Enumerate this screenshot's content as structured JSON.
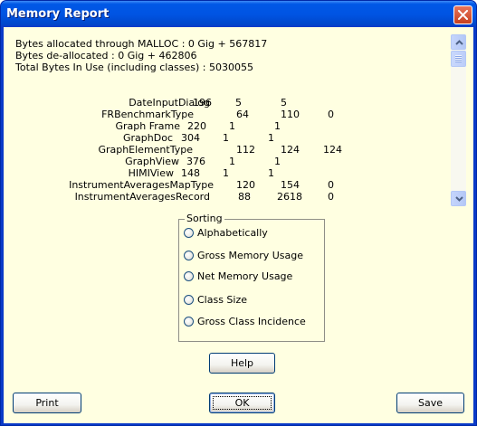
{
  "window": {
    "title": "Memory Report"
  },
  "report": {
    "info_lines": [
      "Bytes allocated through MALLOC : 0 Gig + 567817",
      "Bytes de-allocated : 0 Gig + 462806",
      "Total Bytes In Use (including classes) : 5030055"
    ],
    "rows": [
      {
        "name": "DateInputDialog",
        "values": [
          "196",
          "5",
          "5"
        ]
      },
      {
        "name": "FRBenchmarkType",
        "values": [
          "64",
          "110",
          "0"
        ]
      },
      {
        "name": "Graph Frame",
        "values": [
          "220",
          "1",
          "1"
        ]
      },
      {
        "name": "GraphDoc",
        "values": [
          "304",
          "1",
          "1"
        ]
      },
      {
        "name": "GraphElementType",
        "values": [
          "112",
          "124",
          "124"
        ]
      },
      {
        "name": "GraphView",
        "values": [
          "376",
          "1",
          "1"
        ]
      },
      {
        "name": "HIMIView",
        "values": [
          "148",
          "1",
          "1"
        ]
      },
      {
        "name": "InstrumentAveragesMapType",
        "values": [
          "120",
          "154",
          "0"
        ]
      },
      {
        "name": "InstrumentAveragesRecord",
        "values": [
          "88",
          "2618",
          "0"
        ]
      }
    ]
  },
  "sorting": {
    "title": "Sorting",
    "options": [
      "Alphabetically",
      "Gross Memory Usage",
      "Net Memory Usage",
      "Class Size",
      "Gross Class Incidence"
    ]
  },
  "buttons": {
    "help": "Help",
    "print": "Print",
    "ok": "OK",
    "save": "Save"
  },
  "icons": {
    "close": "close-icon",
    "scroll_up": "scroll-up-arrow-icon",
    "scroll_down": "scroll-down-arrow-icon"
  }
}
